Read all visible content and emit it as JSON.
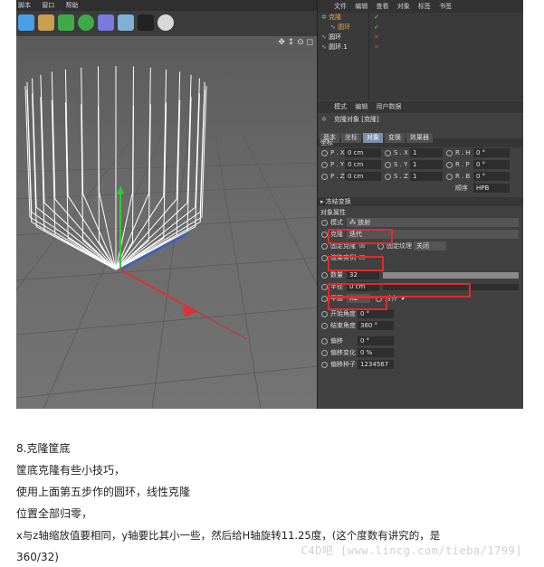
{
  "menubar": {
    "items": [
      "脚本",
      "窗口",
      "帮助"
    ]
  },
  "object_manager": {
    "menu": [
      "文件",
      "编辑",
      "查看",
      "对象",
      "标签",
      "书签"
    ],
    "rows": [
      {
        "name": "克隆",
        "flags": "✓"
      },
      {
        "name": "圆环",
        "flags": "✓"
      },
      {
        "name": "圆环",
        "flags": "✕"
      },
      {
        "name": "圆环.1",
        "flags": "✕"
      }
    ]
  },
  "attributes": {
    "menu": [
      "模式",
      "编辑",
      "用户数据"
    ],
    "title": "克隆对象 [克隆]",
    "tabs": [
      "基本",
      "坐标",
      "对象",
      "变换",
      "效果器"
    ],
    "coords_header": "坐标",
    "coords": [
      {
        "p_label": "P . X",
        "p_val": "0 cm",
        "s_label": "S . X",
        "s_val": "1",
        "r_label": "R . H",
        "r_val": "0 °"
      },
      {
        "p_label": "P . Y",
        "p_val": "0 cm",
        "s_label": "S . Y",
        "s_val": "1",
        "r_label": "R . P",
        "r_val": "0 °"
      },
      {
        "p_label": "P . Z",
        "p_val": "0 cm",
        "s_label": "S . Z",
        "s_val": "1",
        "r_label": "R . B",
        "r_val": "0 °"
      }
    ],
    "order_label": "顺序",
    "order_value": "HPB",
    "freeze_label": "冻结变换",
    "object_props_header": "对象属性",
    "mode_label": "模式",
    "mode_value": "放射",
    "clone_label": "克隆",
    "clone_value": "迭代",
    "fix_clone_label": "固定克隆",
    "fix_texture_label": "固定纹理",
    "fix_texture_value": "关闭",
    "render_instance_label": "渲染实例",
    "count_label": "数量",
    "count_value": "32",
    "radius_label": "半径",
    "radius_value": "0 cm",
    "plane_label": "平面",
    "plane_value": "XZ",
    "align_label": "对齐",
    "start_angle_label": "开始角度",
    "start_angle_value": "0 °",
    "end_angle_label": "结束角度",
    "end_angle_value": "360 °",
    "offset_label": "偏移",
    "offset_value": "0 °",
    "offset_var_label": "偏移变化",
    "offset_var_value": "0 %",
    "offset_seed_label": "偏移种子",
    "offset_seed_value": "1234567"
  },
  "article": {
    "heading": "8.克隆筐底",
    "lines": [
      "筐底克隆有些小技巧，",
      "使用上面第五步作的圆环，线性克隆",
      "位置全部归零，",
      "x与z轴缩放值要相同，y轴要比其小一些，然后给H轴旋转11.25度，(这个度数有讲究的，是",
      "360/32)"
    ]
  },
  "watermark": "C4D吧 [www.lincg.com/tieba/1799]",
  "colors": {
    "highlight": "#e32a2a",
    "tab_active": "#7a8fa8"
  }
}
